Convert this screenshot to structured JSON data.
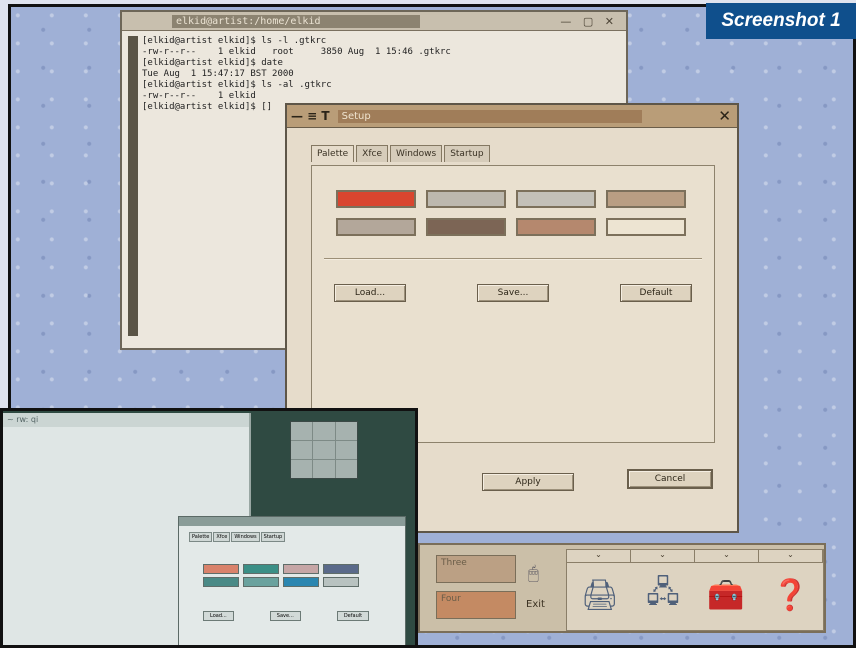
{
  "caption": "Screenshot 1",
  "xterm": {
    "title": "elkid@artist:/home/elkid",
    "controls": "— ▢ ✕",
    "lines": [
      "[elkid@artist elkid]$ ls -l .gtkrc",
      "-rw-r--r--    1 elkid   root     3850 Aug  1 15:46 .gtkrc",
      "[elkid@artist elkid]$ date",
      "Tue Aug  1 15:47:17 BST 2000",
      "[elkid@artist elkid]$ ls -al .gtkrc",
      "-rw-r--r--    1 elkid",
      "[elkid@artist elkid]$ []"
    ]
  },
  "setup": {
    "title_glyphs": "— ≡ T",
    "title": "Setup",
    "close_glyph": "✕",
    "tabs": [
      "Palette",
      "Xfce",
      "Windows",
      "Startup"
    ],
    "swatches": [
      "#d9452f",
      "#bdb8ae",
      "#c3c0b8",
      "#b99e83",
      "#b3a79a",
      "#7c6555",
      "#b5886e",
      "#ede4d2"
    ],
    "buttons": {
      "load": "Load...",
      "save": "Save...",
      "default": "Default"
    },
    "apply": "Apply",
    "cancel": "Cancel"
  },
  "dock": {
    "btn_three": "Three",
    "btn_four": "Four",
    "exit": "Exit",
    "tray_headers": [
      "⌄",
      "⌄",
      "⌄",
      "⌄"
    ]
  },
  "inset": {
    "left_title": "~ rw: qi"
  }
}
